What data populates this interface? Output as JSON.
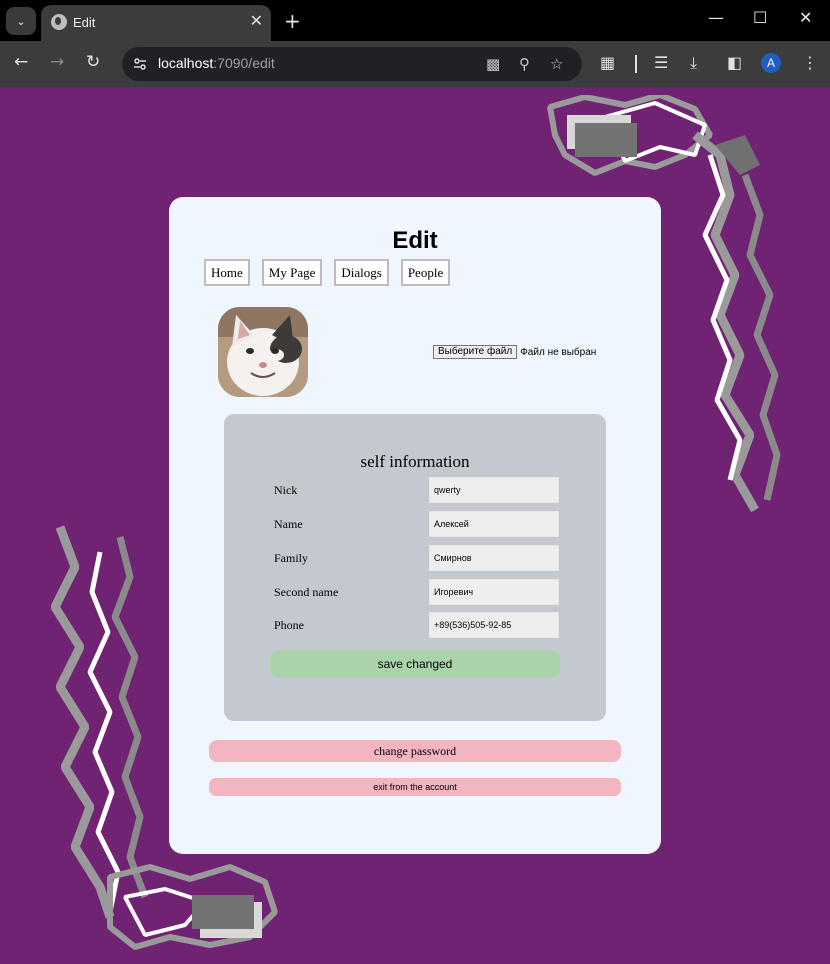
{
  "browser": {
    "tab_title": "Edit",
    "url_host": "localhost",
    "url_path": ":7090/edit"
  },
  "page": {
    "title": "Edit",
    "nav": [
      "Home",
      "My Page",
      "Dialogs",
      "People"
    ],
    "file_input": {
      "button_label": "Выберите файл",
      "status": "Файл не выбран"
    },
    "self_info": {
      "title": "self information",
      "fields": [
        {
          "label": "Nick",
          "value": "qwerty"
        },
        {
          "label": "Name",
          "value": "Алексей"
        },
        {
          "label": "Family",
          "value": "Смирнов"
        },
        {
          "label": "Second name",
          "value": "Игоревич"
        },
        {
          "label": "Phone",
          "value": "+89(536)505-92-85"
        }
      ],
      "save_label": "save changed"
    },
    "change_password_label": "change password",
    "exit_label": "exit from the account"
  },
  "colors": {
    "background": "#702372",
    "card": "#f0f6ff",
    "panel": "#c4c8cf",
    "save_button": "#abd3ab",
    "danger_button": "#f3b5bf"
  }
}
